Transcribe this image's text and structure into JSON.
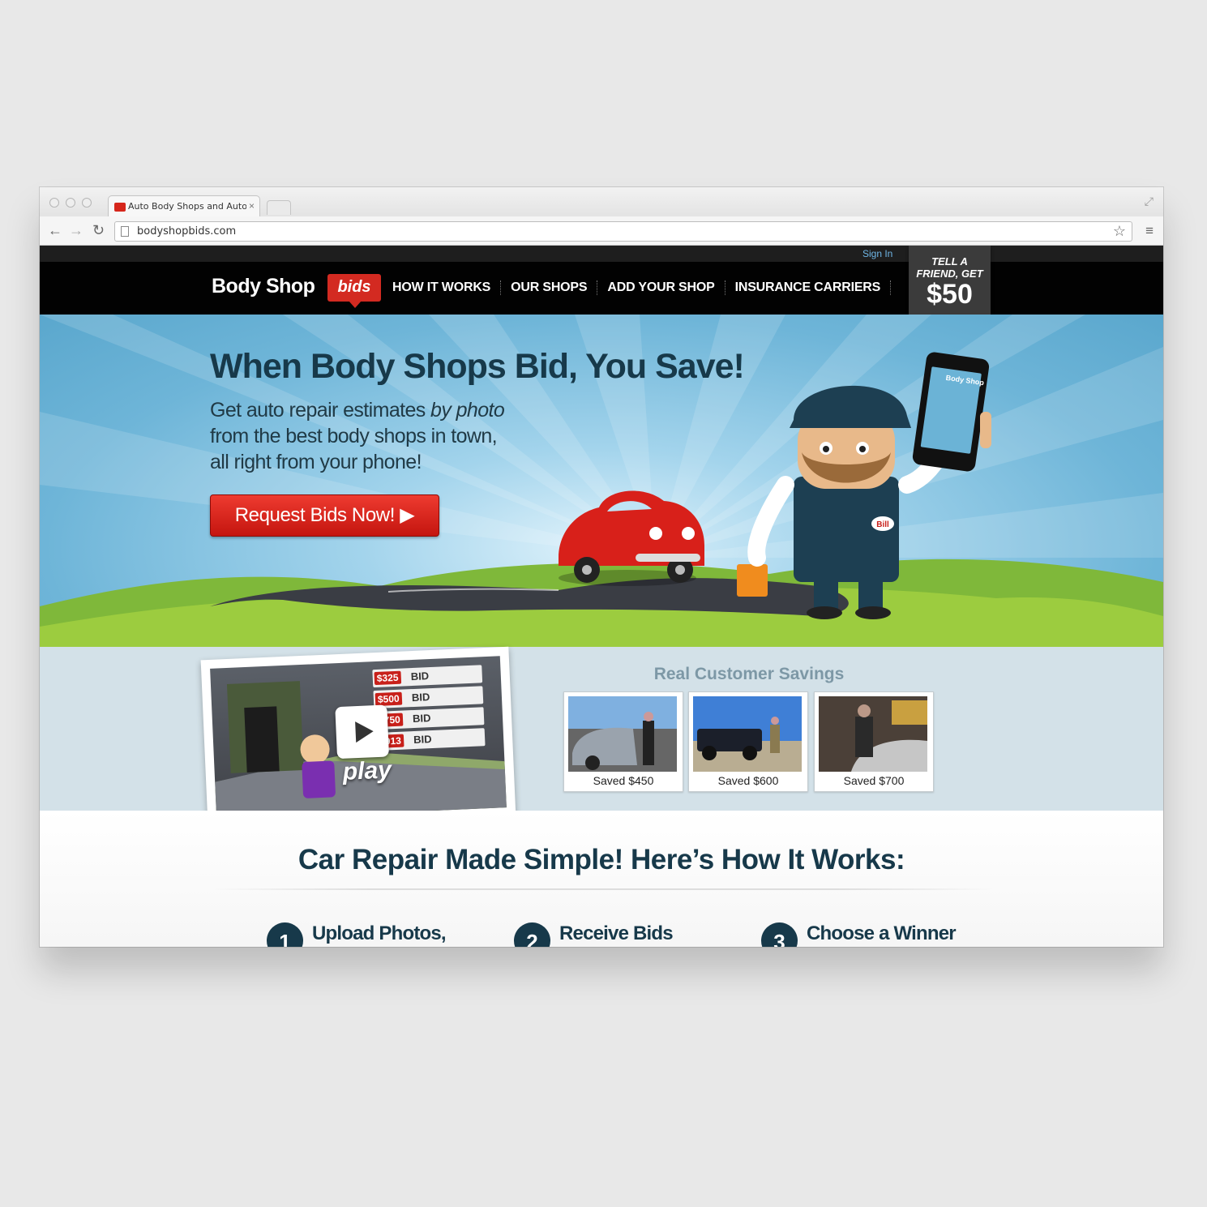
{
  "browser": {
    "tab_title": "Auto Body Shops and Auto",
    "tab_close": "×",
    "url": "bodyshopbids.com",
    "icons": [
      "back-icon",
      "forward-icon",
      "reload-icon",
      "page-icon",
      "star-icon",
      "menu-icon",
      "fullscreen-icon"
    ]
  },
  "site": {
    "sign_in": "Sign In",
    "logo": {
      "main": "Body Shop",
      "badge": "bids"
    },
    "nav": [
      "HOW IT WORKS",
      "OUR SHOPS",
      "ADD YOUR SHOP",
      "INSURANCE CARRIERS"
    ],
    "tell_friend": {
      "line1": "TELL A",
      "line2": "FRIEND, GET",
      "amount": "$50"
    }
  },
  "hero": {
    "headline": "When Body Shops Bid, You Save!",
    "sub_line1_a": "Get auto repair estimates ",
    "sub_line1_em": "by photo",
    "sub_line2": "from the best body shops in town,",
    "sub_line3": "all right from your phone!",
    "cta": "Request Bids Now! ▶",
    "mascot_badge": "Bill",
    "phone_logo": "Body Shop"
  },
  "video": {
    "play_label": "play",
    "bids": [
      {
        "amount": "$325",
        "word": "BID"
      },
      {
        "amount": "$500",
        "word": "BID"
      },
      {
        "amount": "$750",
        "word": "BID"
      },
      {
        "amount": "$913",
        "word": "BID"
      }
    ]
  },
  "savings": {
    "title": "Real Customer Savings",
    "items": [
      {
        "label": "Saved $450"
      },
      {
        "label": "Saved $600"
      },
      {
        "label": "Saved $700"
      }
    ]
  },
  "how": {
    "title": "Car Repair Made Simple! Here’s How It Works:",
    "steps": [
      {
        "num": "1",
        "label": "Upload Photos,"
      },
      {
        "num": "2",
        "label": "Receive Bids"
      },
      {
        "num": "3",
        "label": "Choose a Winner"
      }
    ]
  },
  "colors": {
    "brand_red": "#d32a21",
    "navy": "#17394a",
    "sky": "#6eb5d8",
    "grass": "#8cc63f"
  }
}
